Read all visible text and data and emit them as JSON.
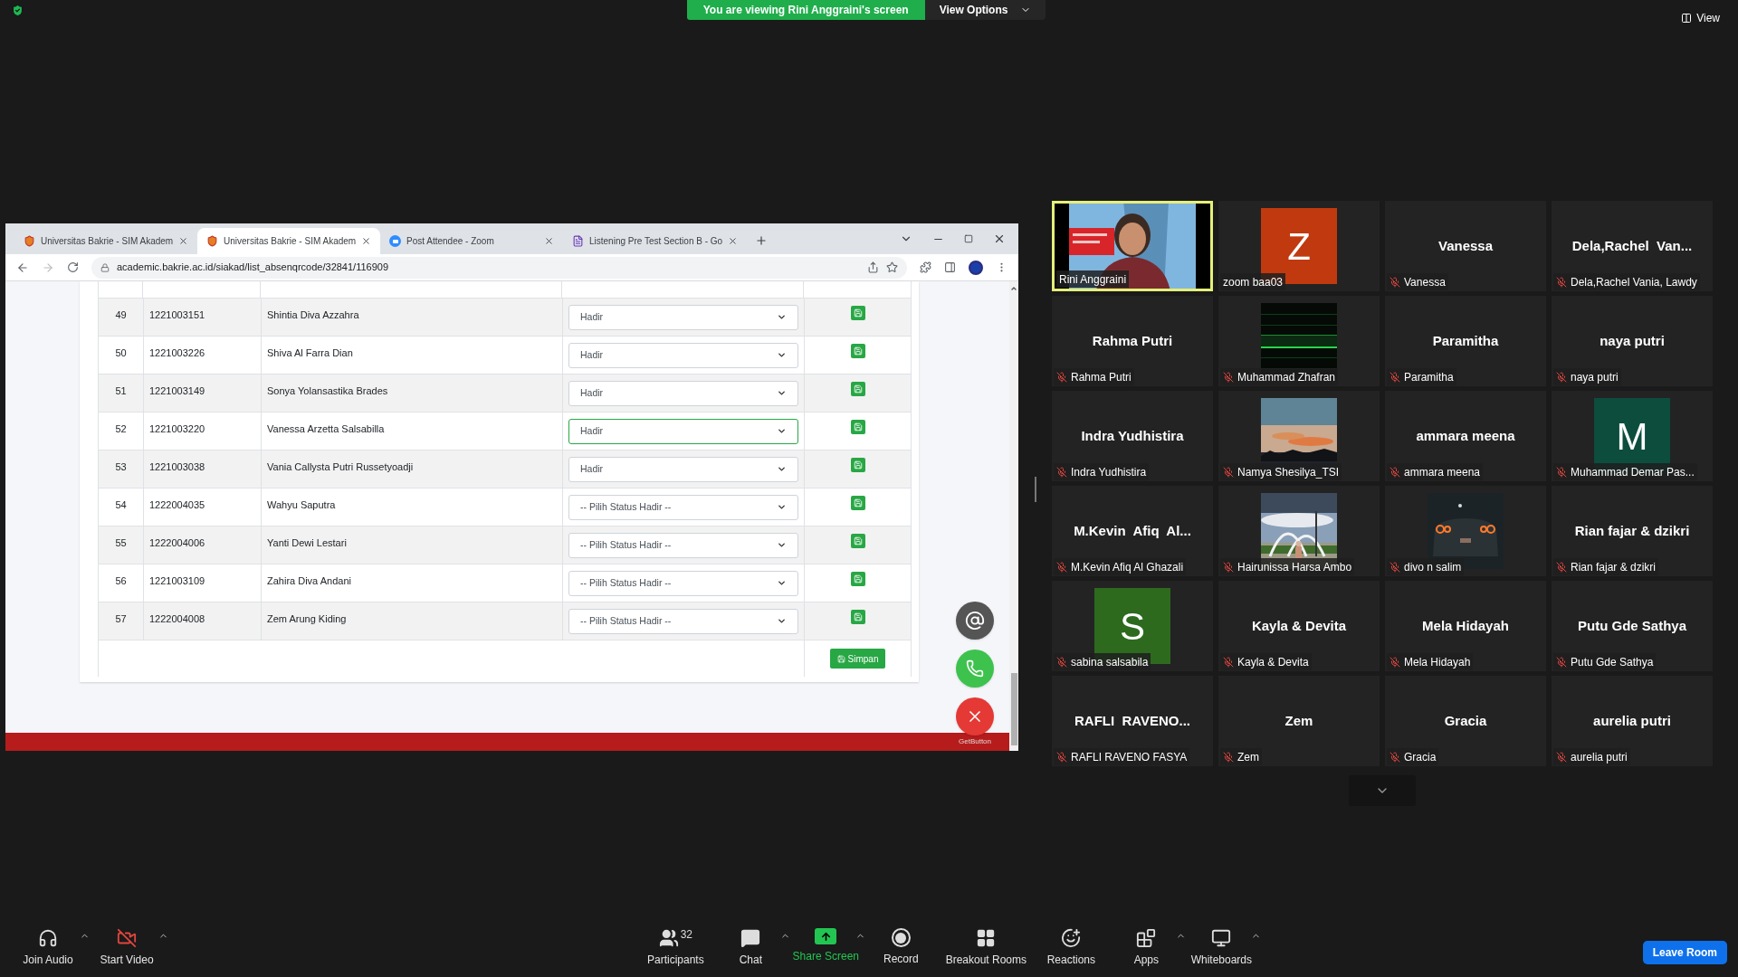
{
  "top_bar": {
    "viewing_banner": "You are viewing Rini Anggraini's screen",
    "view_options": "View Options",
    "view": "View"
  },
  "browser": {
    "tabs": [
      {
        "kind": "shield",
        "label": "Universitas Bakrie - SIM Akadem",
        "selected": false
      },
      {
        "kind": "shield",
        "label": "Universitas Bakrie - SIM Akadem",
        "selected": true
      },
      {
        "kind": "zoom",
        "label": "Post Attendee - Zoom",
        "selected": false
      },
      {
        "kind": "form",
        "label": "Listening Pre Test Section B - Go",
        "selected": false
      }
    ],
    "address": "academic.bakrie.ac.id/siakad/list_absenqrcode/32841/116909"
  },
  "table": {
    "rows": [
      {
        "no": "49",
        "nim": "1221003151",
        "name": "Shintia Diva Azzahra",
        "status": "Hadir",
        "focused": false
      },
      {
        "no": "50",
        "nim": "1221003226",
        "name": "Shiva Al Farra Dian",
        "status": "Hadir",
        "focused": false
      },
      {
        "no": "51",
        "nim": "1221003149",
        "name": "Sonya Yolansastika Brades",
        "status": "Hadir",
        "focused": false
      },
      {
        "no": "52",
        "nim": "1221003220",
        "name": "Vanessa Arzetta Salsabilla",
        "status": "Hadir",
        "focused": true
      },
      {
        "no": "53",
        "nim": "1221003038",
        "name": "Vania Callysta Putri Russetyoadji",
        "status": "Hadir",
        "focused": false
      },
      {
        "no": "54",
        "nim": "1222004035",
        "name": "Wahyu Saputra",
        "status": "-- Pilih Status Hadir --",
        "focused": false
      },
      {
        "no": "55",
        "nim": "1222004006",
        "name": "Yanti Dewi Lestari",
        "status": "-- Pilih Status Hadir --",
        "focused": false
      },
      {
        "no": "56",
        "nim": "1221003109",
        "name": "Zahira Diva Andani",
        "status": "-- Pilih Status Hadir --",
        "focused": false
      },
      {
        "no": "57",
        "nim": "1222004008",
        "name": "Zem Arung Kiding",
        "status": "-- Pilih Status Hadir --",
        "focused": false
      }
    ],
    "submit": "Simpan"
  },
  "floating": {
    "brand": "GetButton"
  },
  "gallery": {
    "tiles": [
      {
        "kind": "picture",
        "label": "Rini Anggraini",
        "muted": false,
        "speaking": true
      },
      {
        "kind": "avatar",
        "letter": "Z",
        "color": "#c1390f",
        "label": "zoom baa03",
        "muted": false,
        "speaking": false
      },
      {
        "kind": "name",
        "display": "Vanessa",
        "label": "Vanessa",
        "muted": true,
        "speaking": false
      },
      {
        "kind": "name",
        "display": "Dela,Rachel  Van...",
        "label": "Dela,Rachel Vania, Lawdy",
        "muted": true,
        "speaking": false
      },
      {
        "kind": "name",
        "display": "Rahma Putri",
        "label": "Rahma Putri",
        "muted": true,
        "speaking": false
      },
      {
        "kind": "picture",
        "label": "Muhammad Zhafran",
        "muted": true,
        "speaking": false
      },
      {
        "kind": "name",
        "display": "Paramitha",
        "label": "Paramitha",
        "muted": true,
        "speaking": false
      },
      {
        "kind": "name",
        "display": "naya putri",
        "label": "naya putri",
        "muted": true,
        "speaking": false
      },
      {
        "kind": "name",
        "display": "Indra Yudhistira",
        "label": "Indra Yudhistira",
        "muted": true,
        "speaking": false
      },
      {
        "kind": "picture",
        "label": "Namya Shesilya_TSI",
        "muted": true,
        "speaking": false
      },
      {
        "kind": "name",
        "display": "ammara meena",
        "label": "ammara meena",
        "muted": true,
        "speaking": false
      },
      {
        "kind": "avatar",
        "letter": "M",
        "color": "#0d4d3d",
        "label": "Muhammad Demar Pas...",
        "muted": true,
        "speaking": false
      },
      {
        "kind": "name",
        "display": "M.Kevin  Afiq  Al...",
        "label": "M.Kevin Afiq Al Ghazali",
        "muted": true,
        "speaking": false
      },
      {
        "kind": "picture",
        "label": "Hairunissa Harsa Ambo",
        "muted": true,
        "speaking": false
      },
      {
        "kind": "picture",
        "label": "divo n salim",
        "muted": true,
        "speaking": false
      },
      {
        "kind": "name",
        "display": "Rian fajar & dzikri",
        "label": "Rian fajar & dzikri",
        "muted": true,
        "speaking": false
      },
      {
        "kind": "avatar",
        "letter": "S",
        "color": "#2d6a1e",
        "label": "sabina salsabila",
        "muted": true,
        "speaking": false
      },
      {
        "kind": "name",
        "display": "Kayla & Devita",
        "label": "Kayla & Devita",
        "muted": true,
        "speaking": false
      },
      {
        "kind": "name",
        "display": "Mela Hidayah",
        "label": "Mela Hidayah",
        "muted": true,
        "speaking": false
      },
      {
        "kind": "name",
        "display": "Putu Gde Sathya",
        "label": "Putu Gde Sathya",
        "muted": true,
        "speaking": false
      },
      {
        "kind": "name",
        "display": "RAFLI  RAVENO...",
        "label": "RAFLI RAVENO FASYA",
        "muted": true,
        "speaking": false
      },
      {
        "kind": "name",
        "display": "Zem",
        "label": "Zem",
        "muted": true,
        "speaking": false
      },
      {
        "kind": "name",
        "display": "Gracia",
        "label": "Gracia",
        "muted": true,
        "speaking": false
      },
      {
        "kind": "name",
        "display": "aurelia putri",
        "label": "aurelia putri",
        "muted": true,
        "speaking": false
      }
    ]
  },
  "toolbar": {
    "left": [
      {
        "kind": "audio",
        "label": "Join Audio",
        "caret": true
      },
      {
        "kind": "video",
        "label": "Start Video",
        "caret": true
      }
    ],
    "center": [
      {
        "kind": "participants",
        "label": "Participants",
        "count": "32",
        "caret": false
      },
      {
        "kind": "chat",
        "label": "Chat",
        "caret": true
      },
      {
        "kind": "share",
        "label": "Share Screen",
        "caret": true
      },
      {
        "kind": "record",
        "label": "Record",
        "caret": false
      },
      {
        "kind": "breakout",
        "label": "Breakout Rooms",
        "caret": false
      },
      {
        "kind": "reactions",
        "label": "Reactions",
        "caret": false
      },
      {
        "kind": "apps",
        "label": "Apps",
        "caret": true
      },
      {
        "kind": "whiteboard",
        "label": "Whiteboards",
        "caret": true
      }
    ],
    "leave": "Leave Room"
  }
}
